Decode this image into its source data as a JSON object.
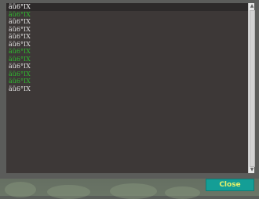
{
  "log": {
    "lines": [
      {
        "text": "äü6°IX",
        "color": "#ffffff"
      },
      {
        "text": "äü6°IX",
        "color": "#2fbf2f"
      },
      {
        "text": "äü6°IX",
        "color": "#e6e6e6"
      },
      {
        "text": "äü6°IX",
        "color": "#e6e6e6"
      },
      {
        "text": "äü6°IX",
        "color": "#e6e6e6"
      },
      {
        "text": "äü6°IX",
        "color": "#e6e6e6"
      },
      {
        "text": "äü6°IX",
        "color": "#2fbf2f"
      },
      {
        "text": "äü6°IX",
        "color": "#2fbf2f"
      },
      {
        "text": "äü6°IX",
        "color": "#e6e6e6"
      },
      {
        "text": "äü6°IX",
        "color": "#2fbf2f"
      },
      {
        "text": "äü6°IX",
        "color": "#2fbf2f"
      },
      {
        "text": "äü6°IX",
        "color": "#e6e6e6"
      }
    ]
  },
  "scrollbar": {
    "up_icon": "chevron-up-icon",
    "down_icon": "chevron-down-icon"
  },
  "footer": {
    "close_label": "Close",
    "close_color": "#149e96",
    "close_text_color": "#e6f26a"
  }
}
